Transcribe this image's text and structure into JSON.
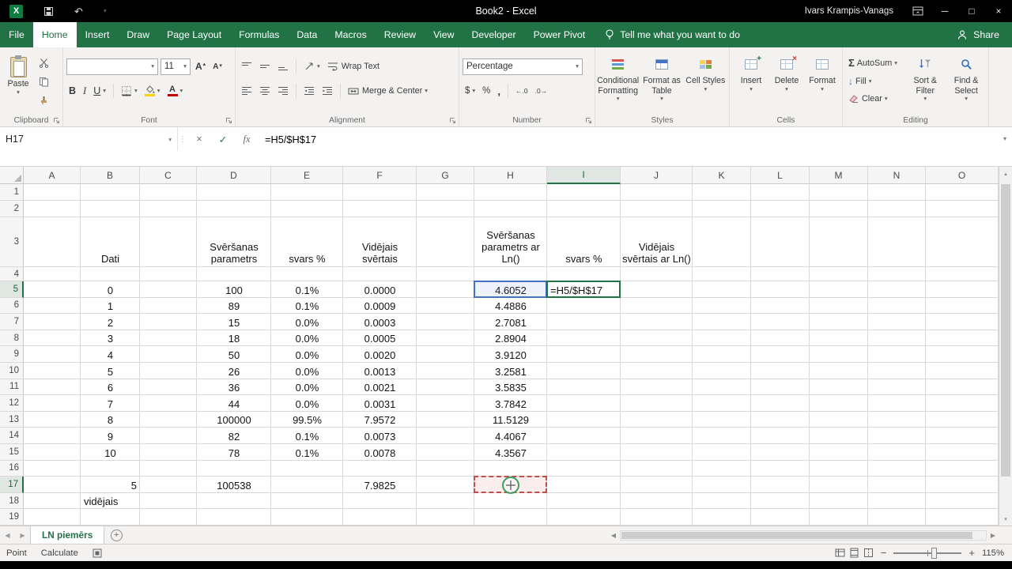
{
  "titlebar": {
    "title": "Book2 - Excel",
    "user": "Ivars Krampis-Vanags"
  },
  "tabrow": {
    "tabs": [
      {
        "label": "File",
        "active": false
      },
      {
        "label": "Home",
        "active": true
      },
      {
        "label": "Insert",
        "active": false
      },
      {
        "label": "Draw",
        "active": false
      },
      {
        "label": "Page Layout",
        "active": false
      },
      {
        "label": "Formulas",
        "active": false
      },
      {
        "label": "Data",
        "active": false
      },
      {
        "label": "Macros",
        "active": false
      },
      {
        "label": "Review",
        "active": false
      },
      {
        "label": "View",
        "active": false
      },
      {
        "label": "Developer",
        "active": false
      },
      {
        "label": "Power Pivot",
        "active": false
      }
    ],
    "tell_me": "Tell me what you want to do",
    "share": "Share"
  },
  "ribbon": {
    "clipboard": {
      "label": "Clipboard",
      "paste": "Paste"
    },
    "font": {
      "label": "Font",
      "name": "",
      "size": "11",
      "bold": "B",
      "italic": "I",
      "underline": "U"
    },
    "alignment": {
      "label": "Alignment",
      "wrap_text": "Wrap Text",
      "merge_center": "Merge & Center"
    },
    "number": {
      "label": "Number",
      "format": "Percentage"
    },
    "styles": {
      "label": "Styles",
      "conditional_formatting": "Conditional Formatting",
      "format_as_table": "Format as Table",
      "cell_styles": "Cell Styles"
    },
    "cells": {
      "label": "Cells",
      "insert": "Insert",
      "delete": "Delete",
      "format": "Format"
    },
    "editing": {
      "label": "Editing",
      "autosum": "AutoSum",
      "fill": "Fill",
      "clear": "Clear",
      "sort_filter": "Sort & Filter",
      "find_select": "Find & Select"
    }
  },
  "formula_bar": {
    "name_box": "H17",
    "formula": "=H5/$H$17"
  },
  "sheet": {
    "columns": [
      "A",
      "B",
      "C",
      "D",
      "E",
      "F",
      "G",
      "H",
      "I",
      "J",
      "K",
      "L",
      "M",
      "N",
      "O"
    ],
    "row_count": 19,
    "cells": {
      "B3": "Dati",
      "D3": "Svēršanas parametrs",
      "E3": "svars %",
      "F3": "Vidējais svērtais",
      "H3": "Svēršanas parametrs ar Ln()",
      "I3": "svars %",
      "J3": "Vidējais svērtais ar Ln()",
      "B5": "0",
      "D5": "100",
      "E5": "0.1%",
      "F5": "0.0000",
      "H5": "4.6052",
      "I5": "=H5/$H$17",
      "B6": "1",
      "D6": "89",
      "E6": "0.1%",
      "F6": "0.0009",
      "H6": "4.4886",
      "B7": "2",
      "D7": "15",
      "E7": "0.0%",
      "F7": "0.0003",
      "H7": "2.7081",
      "B8": "3",
      "D8": "18",
      "E8": "0.0%",
      "F8": "0.0005",
      "H8": "2.8904",
      "B9": "4",
      "D9": "50",
      "E9": "0.0%",
      "F9": "0.0020",
      "H9": "3.9120",
      "B10": "5",
      "D10": "26",
      "E10": "0.0%",
      "F10": "0.0013",
      "H10": "3.2581",
      "B11": "6",
      "D11": "36",
      "E11": "0.0%",
      "F11": "0.0021",
      "H11": "3.5835",
      "B12": "7",
      "D12": "44",
      "E12": "0.0%",
      "F12": "0.0031",
      "H12": "3.7842",
      "B13": "8",
      "D13": "100000",
      "E13": "99.5%",
      "F13": "7.9572",
      "H13": "11.5129",
      "B14": "9",
      "D14": "82",
      "E14": "0.1%",
      "F14": "0.0073",
      "H14": "4.4067",
      "B15": "10",
      "D15": "78",
      "E15": "0.1%",
      "F15": "0.0078",
      "H15": "4.3567",
      "B17": "5",
      "D17": "100538",
      "F17": "7.9825",
      "B18": "vidējais"
    },
    "align_overrides": {
      "B17": "right",
      "B18": "left",
      "I5": "left"
    },
    "wrap_rows": [
      3
    ],
    "selection": {
      "name_box": "H17",
      "editing_cell": "I5",
      "referenced_cell": "H5",
      "point_cell": "H17",
      "selected_column": "I",
      "selected_rows": [
        5,
        17
      ]
    }
  },
  "sheets": {
    "active": "LN piemērs"
  },
  "status": {
    "mode": "Point",
    "calculate": "Calculate",
    "zoom": "115%"
  },
  "colors": {
    "accent": "#217346",
    "reference_blue": "#4472c4",
    "point_red": "#c0504d"
  },
  "icons": {
    "dropdown": "▾",
    "small_up": "▴",
    "undo": "↶",
    "minimize": "─",
    "maximize": "□",
    "close": "×",
    "cancel": "×",
    "enter": "✓",
    "grip": "⋮",
    "fx": "fx",
    "sigma": "Σ",
    "fill_down": "↓",
    "font_letter": "A",
    "dollar": "$",
    "percent": "%",
    "comma": ",",
    "increase_decimal": "←.0",
    "decrease_decimal": ".0→",
    "nav_left": "◀",
    "nav_right": "▶",
    "scroll_up": "▴",
    "scroll_down": "▾",
    "new_sheet": "+",
    "zoom_out": "−",
    "zoom_in": "+"
  }
}
